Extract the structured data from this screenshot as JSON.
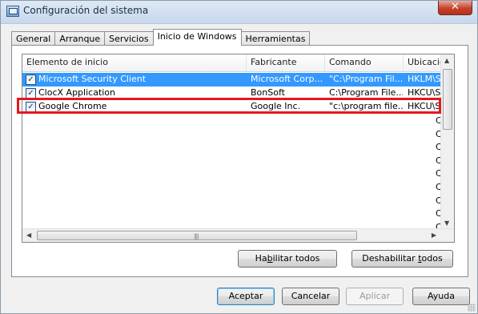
{
  "window": {
    "title": "Configuración del sistema",
    "close_symbol": "✕"
  },
  "tabs": [
    {
      "label": "General",
      "active": false
    },
    {
      "label": "Arranque",
      "active": false
    },
    {
      "label": "Servicios",
      "active": false
    },
    {
      "label": "Inicio de Windows",
      "active": true
    },
    {
      "label": "Herramientas",
      "active": false
    }
  ],
  "startup_list": {
    "columns": [
      "Elemento de inicio",
      "Fabricante",
      "Comando",
      "Ubicación"
    ],
    "rows": [
      {
        "checked": true,
        "item": "Microsoft Security Client",
        "maker": "Microsoft Corp...",
        "command": "\"C:\\Program Fil...",
        "location": "HKLM\\SO",
        "selected": true
      },
      {
        "checked": true,
        "item": "ClocX Application",
        "maker": "BonSoft",
        "command": "C:\\Program File...",
        "location": "HKCU\\SO",
        "selected": false
      },
      {
        "checked": true,
        "item": "Google Chrome",
        "maker": "Google Inc.",
        "command": "\"c:\\program file...",
        "location": "HKCU\\SO",
        "selected": false,
        "highlighted": true
      }
    ],
    "overflow_column_chars": [
      "C",
      "C",
      "C",
      "C",
      "C",
      "C",
      "C",
      "C",
      "C"
    ]
  },
  "buttons": {
    "enable_all": {
      "prefix": "Ha",
      "mnemonic": "b",
      "suffix": "ilitar todos"
    },
    "disable_all": {
      "prefix": "Deshabilitar ",
      "mnemonic": "t",
      "suffix": "odos"
    },
    "ok": "Aceptar",
    "cancel": "Cancelar",
    "apply": "Aplicar",
    "help": "Ayuda"
  },
  "colors": {
    "selection": "#3399ff",
    "highlight_border": "#e3191e"
  }
}
